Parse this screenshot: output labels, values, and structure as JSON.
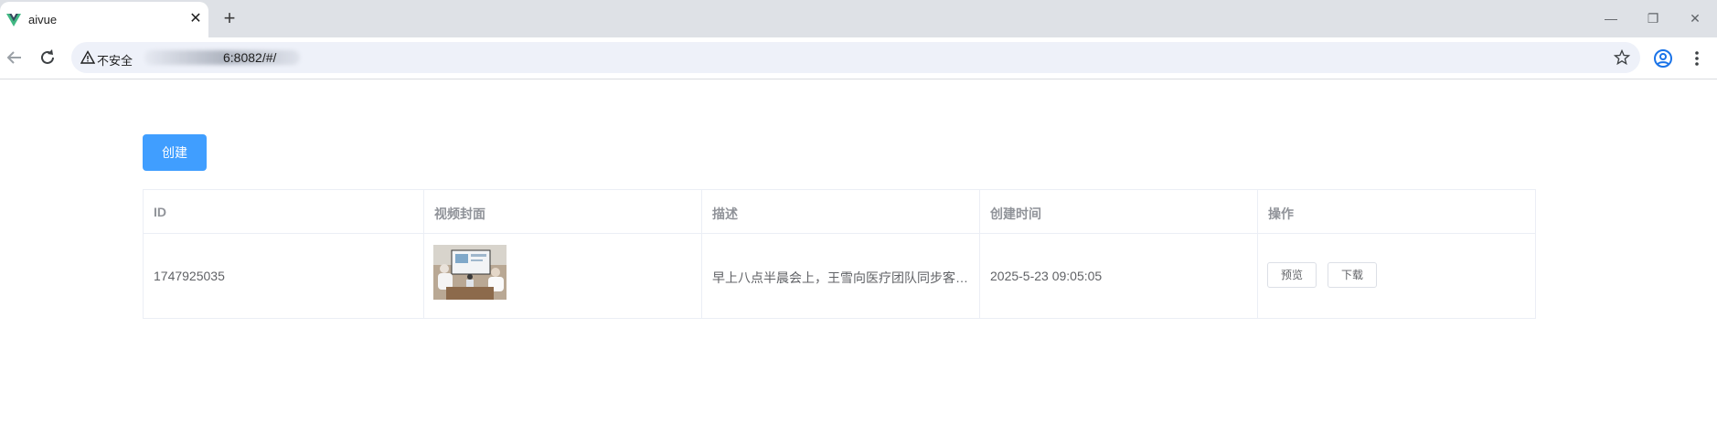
{
  "browser": {
    "tab_title": "aivue",
    "tab_close": "✕",
    "new_tab": "+",
    "security_label": "不安全",
    "url_visible": "6:8082/#/",
    "window_controls": {
      "minimize": "—",
      "restore": "❐",
      "close": "✕"
    }
  },
  "page": {
    "create_label": "创建",
    "table": {
      "headers": [
        "ID",
        "视频封面",
        "描述",
        "创建时间",
        "操作"
      ],
      "rows": [
        {
          "id": "1747925035",
          "description": "早上八点半晨会上，王雪向医疗团队同步客…",
          "created_at": "2025-5-23 09:05:05",
          "actions": [
            "预览",
            "下载"
          ]
        }
      ]
    }
  },
  "colors": {
    "primary": "#409eff",
    "header_text": "#909399",
    "body_text": "#606266",
    "border": "#ebeef5"
  },
  "icons": [
    "vue-logo-icon",
    "close-icon",
    "plus-icon",
    "back-arrow-icon",
    "reload-icon",
    "warning-icon",
    "star-icon",
    "profile-icon",
    "more-vert-icon"
  ]
}
